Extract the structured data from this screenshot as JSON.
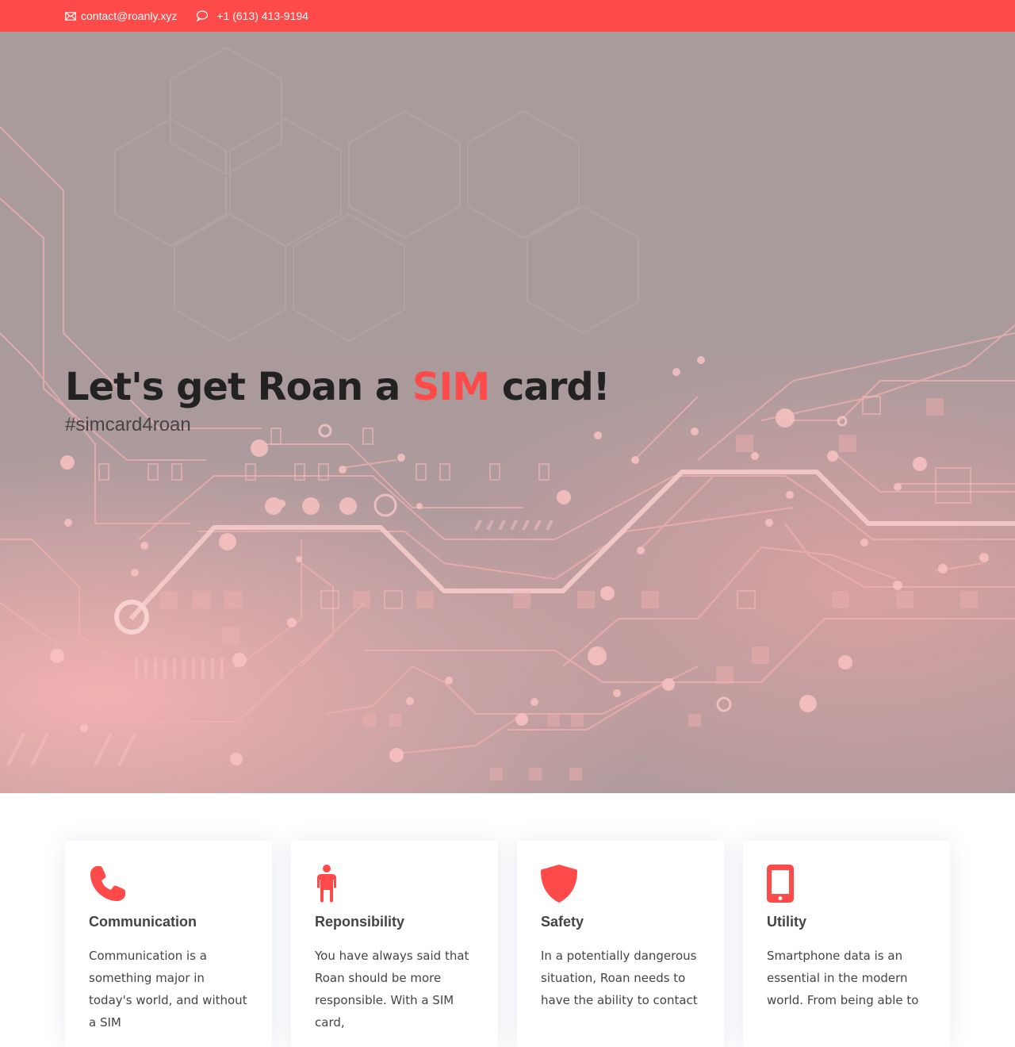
{
  "topbar": {
    "email": "contact@roanly.xyz",
    "phone": "+1 (613) 413-9194",
    "background": "#ff4a4a"
  },
  "hero": {
    "title_prefix": "Let's get Roan a ",
    "title_accent": "SIM",
    "title_suffix": " card!",
    "subtitle": "#simcard4roan",
    "accent_color": "#ff4a4a"
  },
  "features": [
    {
      "icon": "phone-icon",
      "title": "Communication",
      "text": "Communication is a something major in today's world, and without a SIM"
    },
    {
      "icon": "person-icon",
      "title": "Reponsibility",
      "text": "You have always said that Roan should be more responsible. With a SIM card,"
    },
    {
      "icon": "shield-icon",
      "title": "Safety",
      "text": "In a potentially dangerous situation, Roan needs to have the ability to contact"
    },
    {
      "icon": "smartphone-icon",
      "title": "Utility",
      "text": "Smartphone data is an essential in the modern world. From being able to"
    }
  ]
}
